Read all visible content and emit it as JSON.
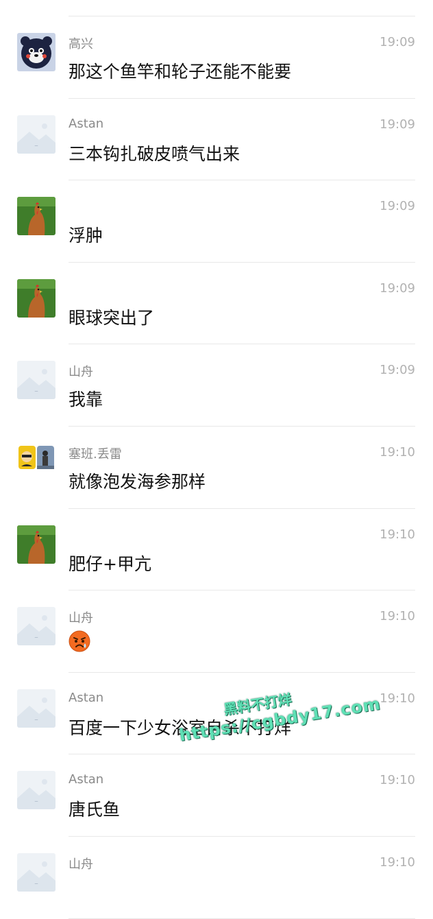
{
  "messages": [
    {
      "sender": "高兴",
      "time": "19:09",
      "text": "那这个鱼竿和轮子还能不能要",
      "avatar": "bear"
    },
    {
      "sender": "Astan",
      "time": "19:09",
      "text": "三本钩扎破皮喷气出来",
      "avatar": "placeholder"
    },
    {
      "sender": "",
      "time": "19:09",
      "text": "浮肿",
      "avatar": "chicken"
    },
    {
      "sender": "",
      "time": "19:09",
      "text": "眼球突出了",
      "avatar": "chicken"
    },
    {
      "sender": "山舟",
      "time": "19:09",
      "text": "我靠",
      "avatar": "placeholder"
    },
    {
      "sender": "塞班.丢雷",
      "time": "19:10",
      "text": "就像泡发海参那样",
      "avatar": "duo"
    },
    {
      "sender": "",
      "time": "19:10",
      "text": "肥仔+甲亢",
      "avatar": "chicken"
    },
    {
      "sender": "山舟",
      "time": "19:10",
      "text": "",
      "avatar": "placeholder",
      "emoji": "scared-face-emoji"
    },
    {
      "sender": "Astan",
      "time": "19:10",
      "text": "百度一下少女浴室自杀不打烊",
      "avatar": "placeholder"
    },
    {
      "sender": "Astan",
      "time": "19:10",
      "text": "唐氏鱼",
      "avatar": "placeholder"
    },
    {
      "sender": "山舟",
      "time": "19:10",
      "text": "",
      "avatar": "placeholder"
    }
  ],
  "watermark": {
    "line1": "黑料不打烊",
    "line2": "https://cgbdy17.com"
  },
  "colors": {
    "accent": "#5fe0b5",
    "time": "#b2b2b2",
    "name": "#8a8a8a"
  }
}
